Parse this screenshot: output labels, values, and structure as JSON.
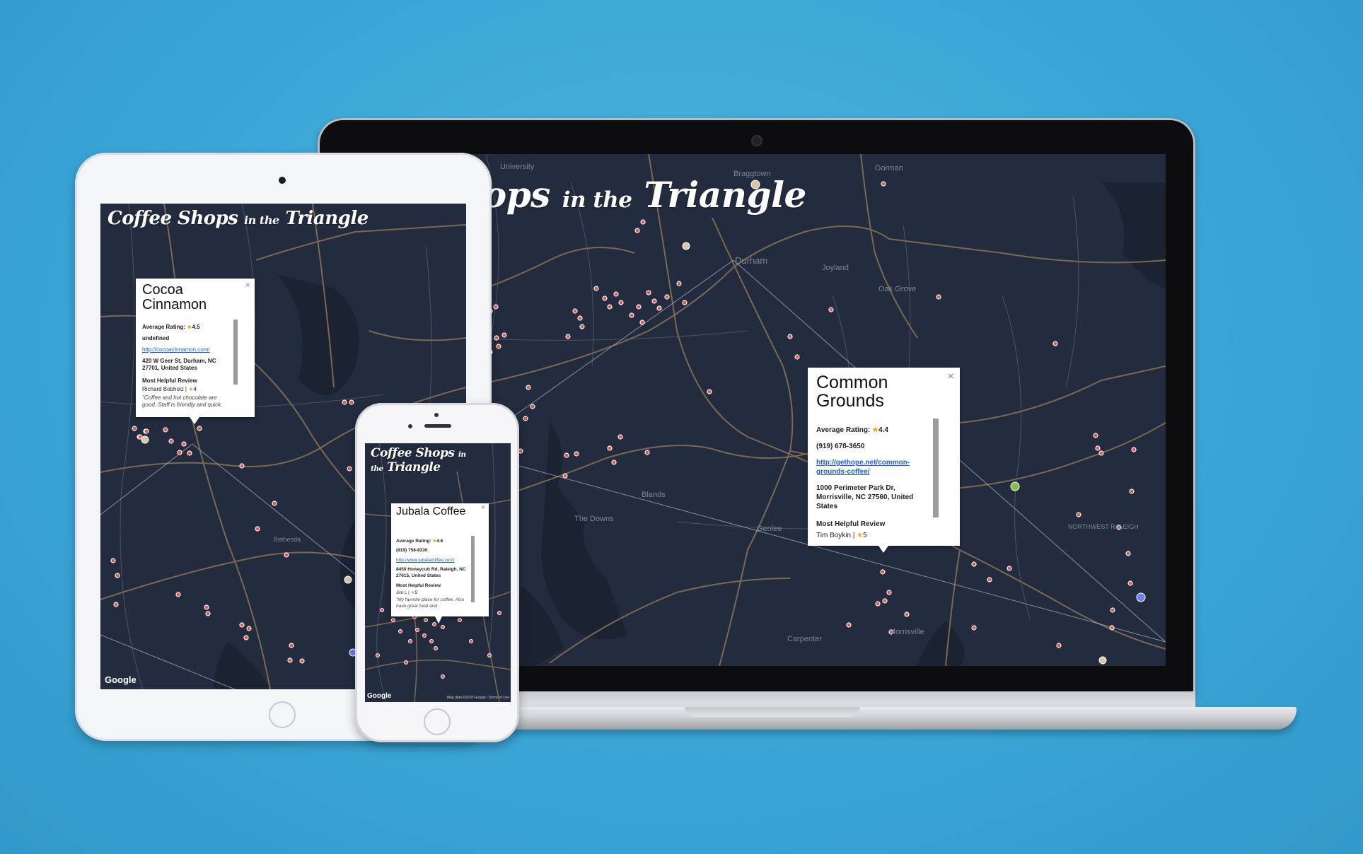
{
  "app": {
    "title_a": "Coffee Shops",
    "title_b": "in the",
    "title_c": "Triangle",
    "laptop_title_a": "hops",
    "google": "Google",
    "map_footer": "Map data ©2018 Google | Terms of Use"
  },
  "map_labels": {
    "laptop": [
      "University",
      "Braggtown",
      "Gorman",
      "Durham",
      "Joyland",
      "Oak Grove",
      "Blands",
      "The Downs",
      "Genlee",
      "NORTHWEST RALEIGH",
      "Carpenter",
      "Morrisville"
    ],
    "tablet": [
      "Bethesda"
    ],
    "phone": []
  },
  "laptop_info": {
    "name": "Common Grounds",
    "rating_label": "Average Rating:",
    "rating": "4.4",
    "phone": "(919) 678-3650",
    "link": "http://gethope.net/common-grounds-coffee/",
    "address": "1000 Perimeter Park Dr, Morrisville, NC 27560, United States",
    "review_label": "Most Helpful Review",
    "reviewer": "Tim Boykin",
    "review_rating": "5",
    "close": "×"
  },
  "tablet_info": {
    "name": "Cocoa Cinnamon",
    "rating_label": "Average Rating:",
    "rating": "4.5",
    "phone": "undefined",
    "link": "http://cocoacinnamon.com/",
    "address": "420 W Geer St, Durham, NC 27701, United States",
    "review_label": "Most Helpful Review",
    "reviewer": "Richard Bobholz",
    "review_rating": "4",
    "quote": "\"Coffee and hot chocolate are good. Staff is friendly and quick.",
    "close": "×"
  },
  "phone_info": {
    "name": "Jubala Coffee",
    "rating_label": "Average Rating:",
    "rating": "4.6",
    "phone": "(919) 758-8330",
    "link": "http://www.jubalacoffee.com/",
    "address": "8450 Honeycutt Rd, Raleigh, NC 27615, United States",
    "review_label": "Most Helpful Review",
    "reviewer": "Jim L",
    "review_rating": "5",
    "quote": "\"My favorite place for coffee. Also have great food and",
    "close": "×"
  },
  "colors": {
    "background": "#3ba6d6",
    "map": "#232c3e",
    "road": "#8a7455",
    "marker": "#e5534b",
    "water": "#1b2232"
  }
}
